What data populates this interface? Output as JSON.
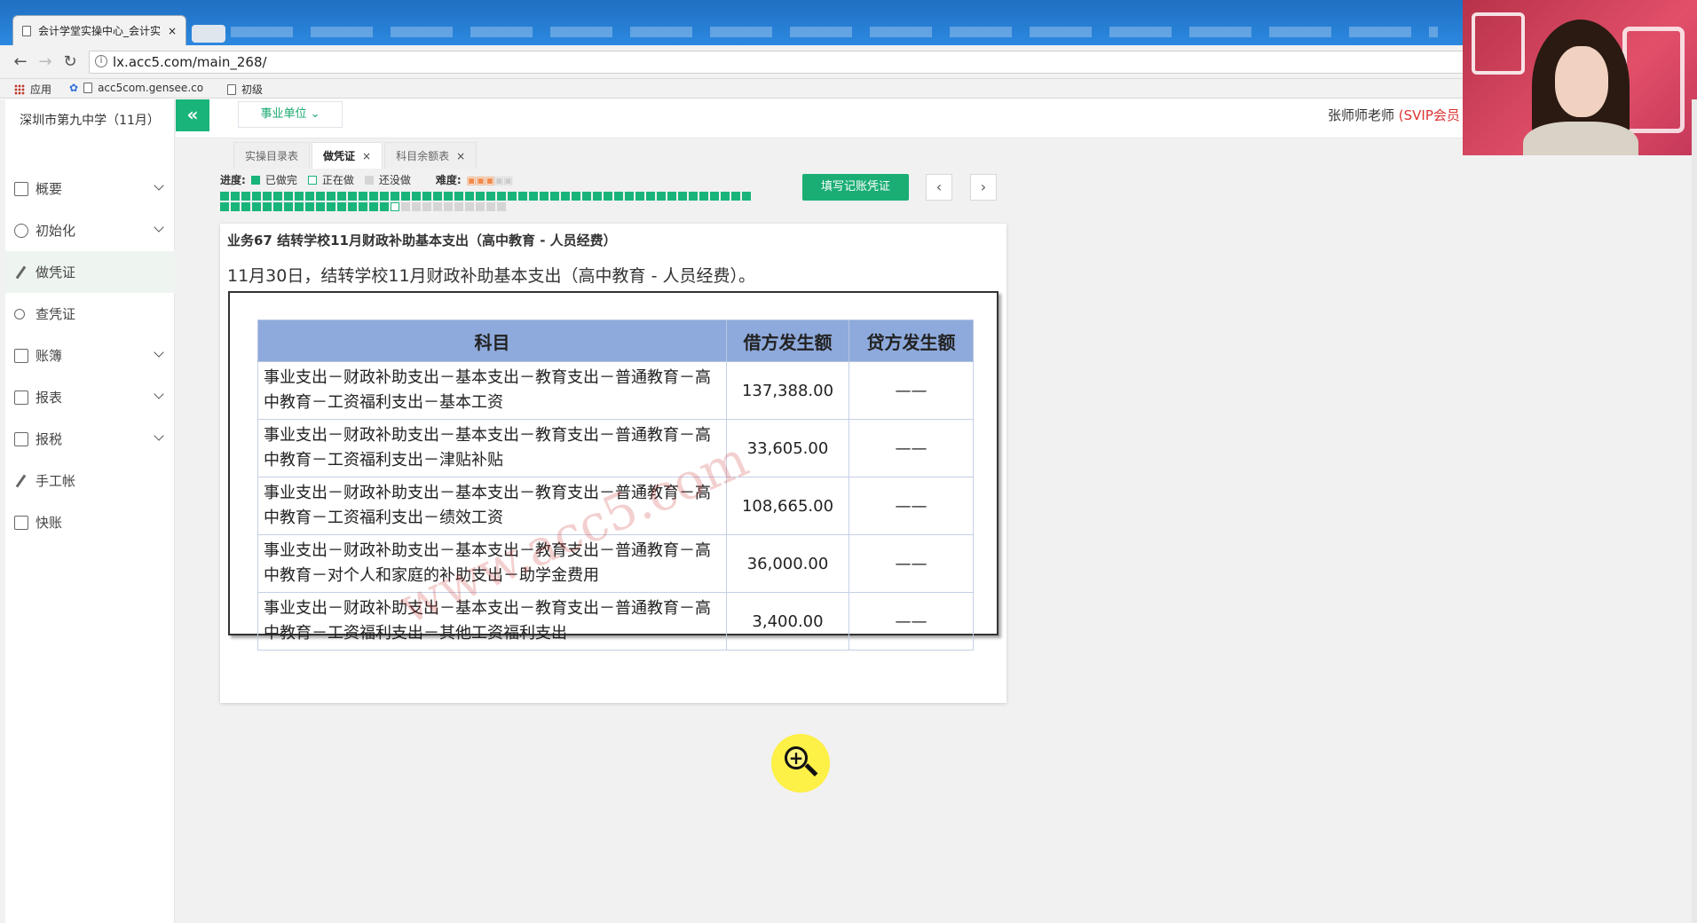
{
  "browser": {
    "tab_title": "会计学堂实操中心_会计实",
    "tab_close": "×",
    "url": "lx.acc5.com/main_268/",
    "bookmarks": [
      {
        "label": "应用"
      },
      {
        "label": "acc5com.gensee.co"
      },
      {
        "label": "初级"
      }
    ]
  },
  "sidebar": {
    "company": "深圳市第九中学（11月）",
    "items": [
      {
        "label": "概要",
        "icon": "grid-icon",
        "has_chevron": true
      },
      {
        "label": "初始化",
        "icon": "gear-icon",
        "has_chevron": true
      },
      {
        "label": "做凭证",
        "icon": "pen-icon",
        "active": true
      },
      {
        "label": "查凭证",
        "icon": "search-icon"
      },
      {
        "label": "账簿",
        "icon": "book-icon",
        "has_chevron": true
      },
      {
        "label": "报表",
        "icon": "report-icon",
        "has_chevron": true
      },
      {
        "label": "报税",
        "icon": "document-icon",
        "has_chevron": true
      },
      {
        "label": "手工帐",
        "icon": "pen-icon"
      },
      {
        "label": "快账",
        "icon": "document-icon"
      }
    ]
  },
  "topbar": {
    "collapse": "«",
    "unit_select": "事业单位",
    "teacher": "张师师老师",
    "vip": "(SVIP会员"
  },
  "tabs": [
    {
      "label": "实操目录表",
      "closable": false
    },
    {
      "label": "做凭证",
      "closable": true,
      "active": true
    },
    {
      "label": "科目余额表",
      "closable": true
    }
  ],
  "progress": {
    "label": "进度:",
    "done": "已做完",
    "doing": "正在做",
    "todo": "还没做",
    "difficulty_label": "难度:",
    "difficulty": 3,
    "difficulty_max": 5,
    "done_count": 66,
    "doing_index": 67,
    "total": 77
  },
  "actions": {
    "fill_voucher": "填写记账凭证",
    "prev": "‹",
    "next": "›"
  },
  "task": {
    "title": "业务67 结转学校11月财政补助基本支出（高中教育 - 人员经费）",
    "description": "11月30日，结转学校11月财政补助基本支出（高中教育 - 人员经费）。",
    "watermark": "www.acc5.com"
  },
  "voucher": {
    "headers": [
      "科目",
      "借方发生额",
      "贷方发生额"
    ],
    "rows": [
      {
        "account": "事业支出－财政补助支出－基本支出－教育支出－普通教育－高中教育－工资福利支出－基本工资",
        "debit": "137,388.00",
        "credit": "——"
      },
      {
        "account": "事业支出－财政补助支出－基本支出－教育支出－普通教育－高中教育－工资福利支出－津贴补贴",
        "debit": "33,605.00",
        "credit": "——"
      },
      {
        "account": "事业支出－财政补助支出－基本支出－教育支出－普通教育－高中教育－工资福利支出－绩效工资",
        "debit": "108,665.00",
        "credit": "——"
      },
      {
        "account": "事业支出－财政补助支出－基本支出－教育支出－普通教育－高中教育－对个人和家庭的补助支出－助学金费用",
        "debit": "36,000.00",
        "credit": "——"
      },
      {
        "account": "事业支出－财政补助支出－基本支出－教育支出－普通教育－高中教育－工资福利支出－其他工资福利支出",
        "debit": "3,400.00",
        "credit": "——"
      }
    ]
  },
  "colors": {
    "accent": "#19b47a",
    "table_header": "#8eaadc",
    "vip_red": "#dd3333"
  }
}
